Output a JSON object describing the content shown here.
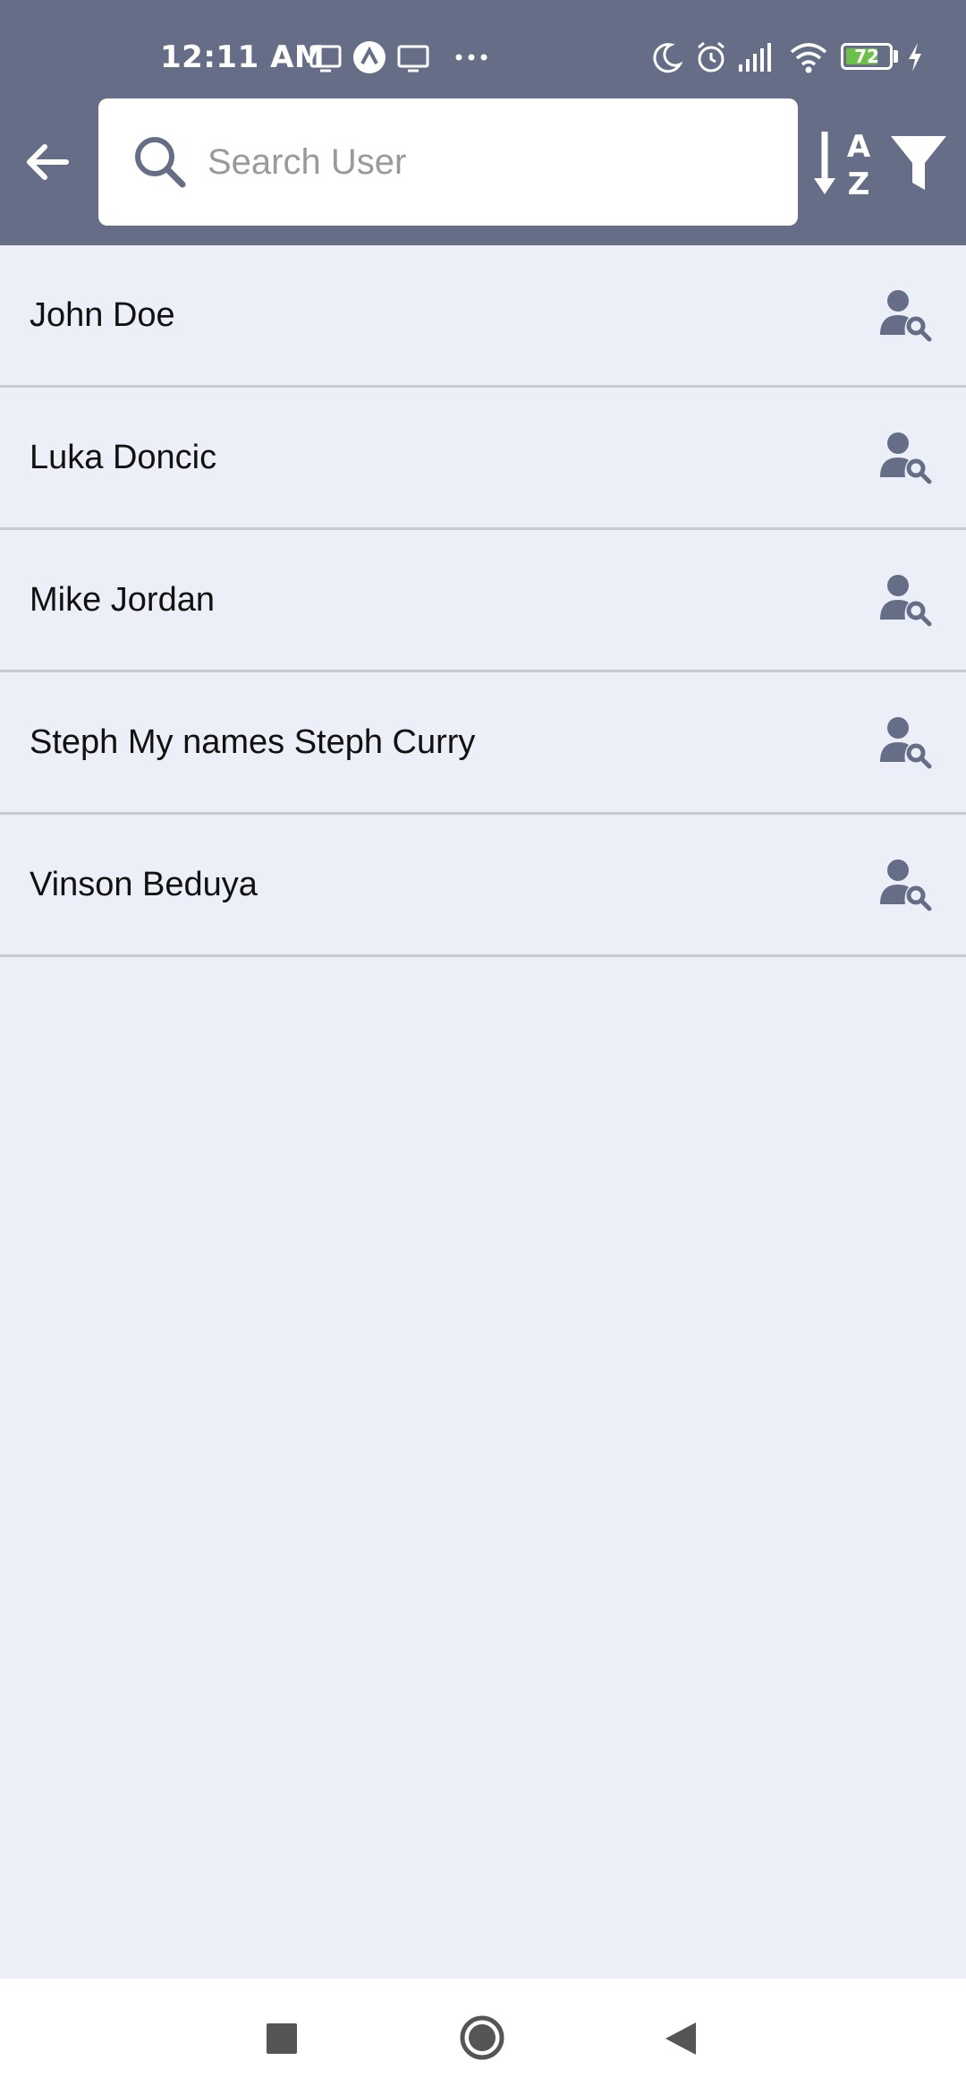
{
  "status_bar": {
    "time": "12:11 AM",
    "battery_level": "72",
    "icons": [
      "screen-cast-icon",
      "app-notification-icon",
      "screen-cast-icon",
      "more-notifications-icon",
      "moon-icon",
      "alarm-icon",
      "signal-icon",
      "wifi-icon",
      "battery-icon",
      "charging-icon"
    ]
  },
  "header": {
    "search_placeholder": "Search User",
    "back_icon": "arrow-left-icon",
    "sort_icon": "sort-alpha-icon",
    "filter_icon": "filter-icon"
  },
  "users": [
    {
      "name": "John Doe"
    },
    {
      "name": "Luka Doncic"
    },
    {
      "name": "Mike Jordan"
    },
    {
      "name": "Steph My names Steph Curry"
    },
    {
      "name": "Vinson Beduya"
    }
  ],
  "colors": {
    "header_bg": "#656E86",
    "list_bg": "#ECEFF8",
    "divider": "#C9CBCE",
    "icon": "#656E86",
    "battery_fill": "#6CC04A"
  },
  "nav_bar": {
    "icons": [
      "recents-icon",
      "home-icon",
      "back-icon"
    ]
  }
}
